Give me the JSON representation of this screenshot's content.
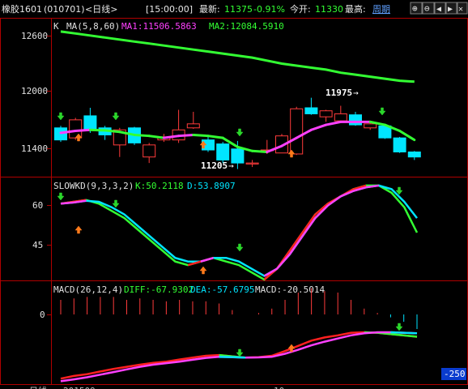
{
  "header": {
    "instrument": "橡胶1601",
    "code": "(010701)",
    "period": "<日线>",
    "time": "[15:00:00]",
    "latest_label": "最新:",
    "latest_value": "11375",
    "change_pct": "-0.91%",
    "open_label": "今开:",
    "open_value": "11330",
    "high_label": "最高:",
    "weekly_button": "周期",
    "nav_buttons": [
      "⊕",
      "⊖",
      "◀",
      "▶",
      "✕"
    ]
  },
  "main_panel": {
    "label": "K",
    "ma_label": "MA(5,8,60)",
    "ma1": "MA1:11506.5863",
    "ma2": "MA2:12084.5910",
    "y_ticks": [
      12600,
      12000,
      11400
    ],
    "annotations": [
      "11975",
      "11205"
    ]
  },
  "kd_panel": {
    "label": "SLOWKD(9,3,3,2)",
    "k": "K:50.2118",
    "d": "D:53.8907",
    "y_ticks": [
      60,
      45
    ]
  },
  "macd_panel": {
    "label": "MACD(26,12,4)",
    "diff": "DIFF:-67.9302",
    "dea": "DEA:-57.6795",
    "macd": "MACD:-20.5014",
    "y_ticks": [
      0
    ],
    "badge": "-250"
  },
  "footer": {
    "left": "日线",
    "date_left": "201509",
    "mid": "10"
  },
  "colors": {
    "up": "#ff3b3b",
    "down": "#00e5ff",
    "ma1": "#ff40ff",
    "ma2": "#33ff33",
    "frame": "#b00000",
    "text": "#c0c0c0"
  },
  "chart_data": [
    {
      "type": "candlestick",
      "title": "",
      "ylim": [
        11150,
        12700
      ],
      "candles": [
        {
          "o": 11620,
          "c": 11500,
          "h": 11640,
          "l": 11480
        },
        {
          "o": 11520,
          "c": 11700,
          "h": 11720,
          "l": 11500
        },
        {
          "o": 11740,
          "c": 11600,
          "h": 11820,
          "l": 11570
        },
        {
          "o": 11620,
          "c": 11550,
          "h": 11640,
          "l": 11500
        },
        {
          "o": 11450,
          "c": 11600,
          "h": 11620,
          "l": 11330
        },
        {
          "o": 11620,
          "c": 11470,
          "h": 11630,
          "l": 11450
        },
        {
          "o": 11330,
          "c": 11450,
          "h": 11470,
          "l": 11270
        },
        {
          "o": 11500,
          "c": 11530,
          "h": 11560,
          "l": 11480
        },
        {
          "o": 11500,
          "c": 11600,
          "h": 11800,
          "l": 11470
        },
        {
          "o": 11620,
          "c": 11660,
          "h": 11780,
          "l": 11610
        },
        {
          "o": 11500,
          "c": 11400,
          "h": 11530,
          "l": 11380
        },
        {
          "o": 11460,
          "c": 11300,
          "h": 11480,
          "l": 11270
        },
        {
          "o": 11410,
          "c": 11270,
          "h": 11490,
          "l": 11210
        },
        {
          "o": 11260,
          "c": 11270,
          "h": 11300,
          "l": 11230
        },
        {
          "o": 11400,
          "c": 11400,
          "h": 11500,
          "l": 11360
        },
        {
          "o": 11370,
          "c": 11540,
          "h": 11560,
          "l": 11370
        },
        {
          "o": 11360,
          "c": 11810,
          "h": 11830,
          "l": 11350
        },
        {
          "o": 11820,
          "c": 11760,
          "h": 11920,
          "l": 11750
        },
        {
          "o": 11730,
          "c": 11790,
          "h": 11800,
          "l": 11680
        },
        {
          "o": 11690,
          "c": 11760,
          "h": 11840,
          "l": 11680
        },
        {
          "o": 11750,
          "c": 11650,
          "h": 11780,
          "l": 11640
        },
        {
          "o": 11620,
          "c": 11660,
          "h": 11670,
          "l": 11600
        },
        {
          "o": 11640,
          "c": 11520,
          "h": 11660,
          "l": 11510
        },
        {
          "o": 11520,
          "c": 11380,
          "h": 11530,
          "l": 11370
        },
        {
          "o": 11380,
          "c": 11330,
          "h": 11390,
          "l": 11300
        }
      ],
      "ma1": [
        11570,
        11590,
        11600,
        11595,
        11580,
        11550,
        11540,
        11520,
        11540,
        11550,
        11540,
        11520,
        11430,
        11390,
        11380,
        11440,
        11520,
        11600,
        11650,
        11680,
        11680,
        11680,
        11650,
        11590,
        11500
      ],
      "ma2": [
        12580,
        12560,
        12540,
        12520,
        12500,
        12480,
        12460,
        12440,
        12420,
        12400,
        12380,
        12360,
        12340,
        12320,
        12290,
        12260,
        12240,
        12220,
        12200,
        12170,
        12150,
        12130,
        12110,
        12090,
        12080
      ]
    },
    {
      "type": "line",
      "title": "",
      "ylim": [
        37,
        65
      ],
      "series": [
        {
          "name": "K",
          "values": [
            58,
            58.5,
            59,
            58,
            56,
            54,
            51,
            48,
            45,
            42,
            41,
            42,
            43,
            42,
            41,
            39,
            37,
            40,
            45,
            50,
            55,
            58,
            60,
            62,
            63,
            63,
            61,
            57,
            50
          ]
        },
        {
          "name": "D",
          "values": [
            58,
            58.3,
            58.8,
            58.5,
            57,
            55,
            52,
            49,
            46,
            43,
            42,
            42,
            43,
            43,
            42,
            40,
            38,
            40,
            44,
            49,
            54,
            57.5,
            60,
            61.5,
            62.5,
            63,
            62,
            58.5,
            54
          ]
        }
      ]
    },
    {
      "type": "line",
      "title": "",
      "ylim": [
        -260,
        10
      ],
      "series": [
        {
          "name": "DIFF",
          "values": [
            -245,
            -235,
            -228,
            -218,
            -208,
            -200,
            -192,
            -185,
            -180,
            -172,
            -165,
            -158,
            -155,
            -160,
            -165,
            -163,
            -158,
            -140,
            -120,
            -100,
            -88,
            -80,
            -70,
            -68,
            -70,
            -75,
            -80,
            -85
          ]
        },
        {
          "name": "DEA",
          "values": [
            -255,
            -248,
            -240,
            -230,
            -220,
            -210,
            -200,
            -192,
            -186,
            -180,
            -173,
            -166,
            -162,
            -163,
            -165,
            -164,
            -162,
            -150,
            -135,
            -118,
            -104,
            -92,
            -80,
            -72,
            -68,
            -68,
            -70,
            -72
          ]
        }
      ],
      "bars": [
        20,
        22,
        24,
        24,
        24,
        20,
        22,
        20,
        18,
        20,
        18,
        18,
        15,
        6,
        0,
        2,
        8,
        20,
        30,
        36,
        32,
        30,
        20,
        8,
        2,
        -4,
        -10,
        -20
      ]
    }
  ]
}
